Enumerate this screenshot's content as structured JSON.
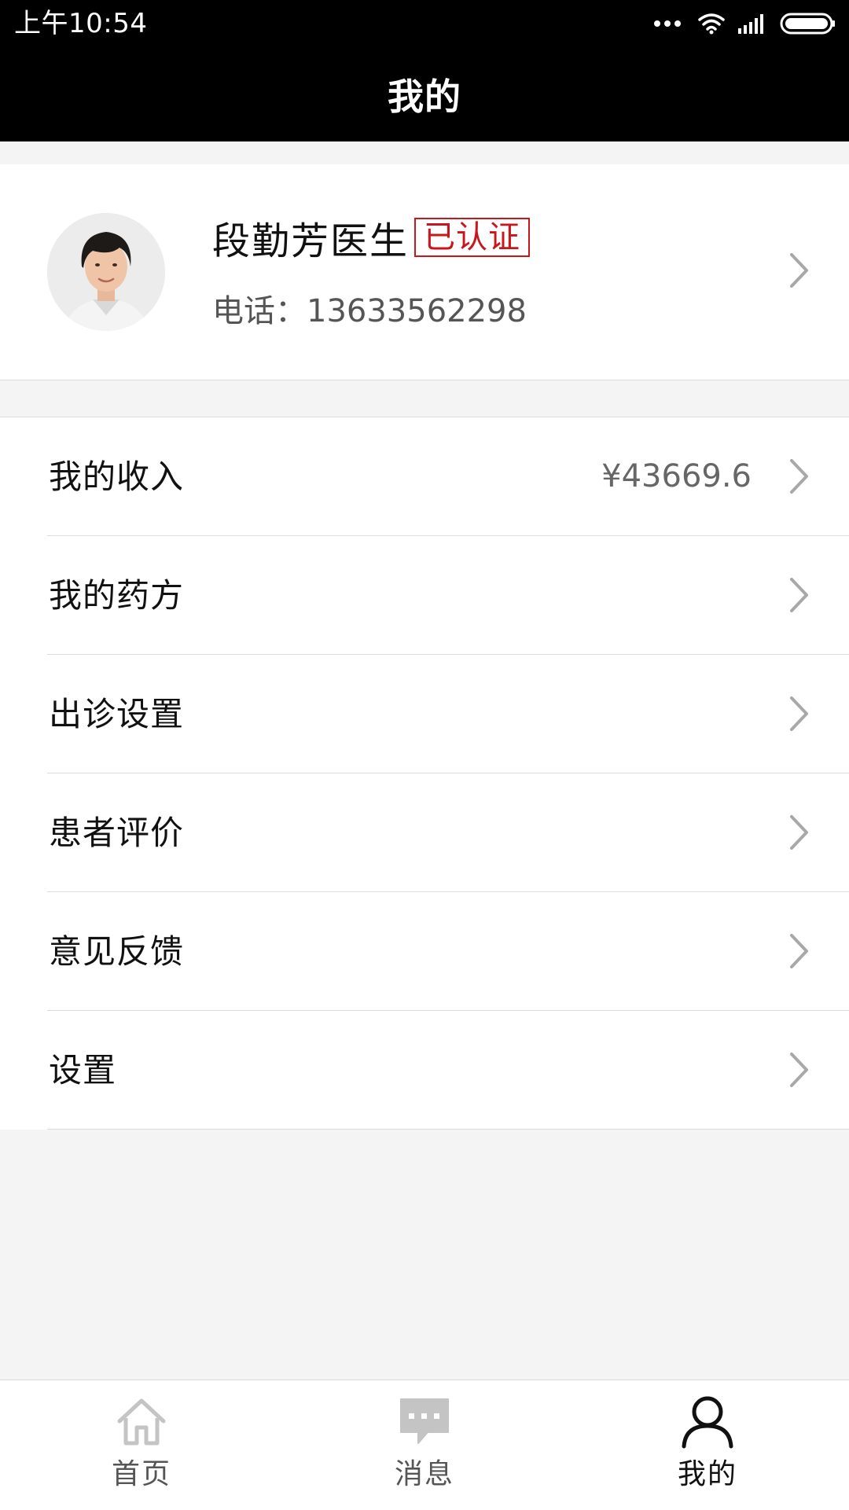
{
  "status_bar": {
    "time": "上午10:54"
  },
  "header": {
    "title": "我的"
  },
  "profile": {
    "name": "段勤芳医生",
    "badge": "已认证",
    "phone_label": "电话：",
    "phone": "13633562298"
  },
  "menu": {
    "items": [
      {
        "label": "我的收入",
        "value": "¥43669.6"
      },
      {
        "label": "我的药方"
      },
      {
        "label": "出诊设置"
      },
      {
        "label": "患者评价"
      },
      {
        "label": "意见反馈"
      },
      {
        "label": "设置"
      }
    ]
  },
  "tabs": [
    {
      "label": "首页",
      "icon": "home-icon"
    },
    {
      "label": "消息",
      "icon": "message-icon"
    },
    {
      "label": "我的",
      "icon": "user-icon",
      "active": true
    }
  ],
  "colors": {
    "header_bg": "#000000",
    "badge_red": "#c8161d",
    "page_bg": "#f4f4f4"
  }
}
